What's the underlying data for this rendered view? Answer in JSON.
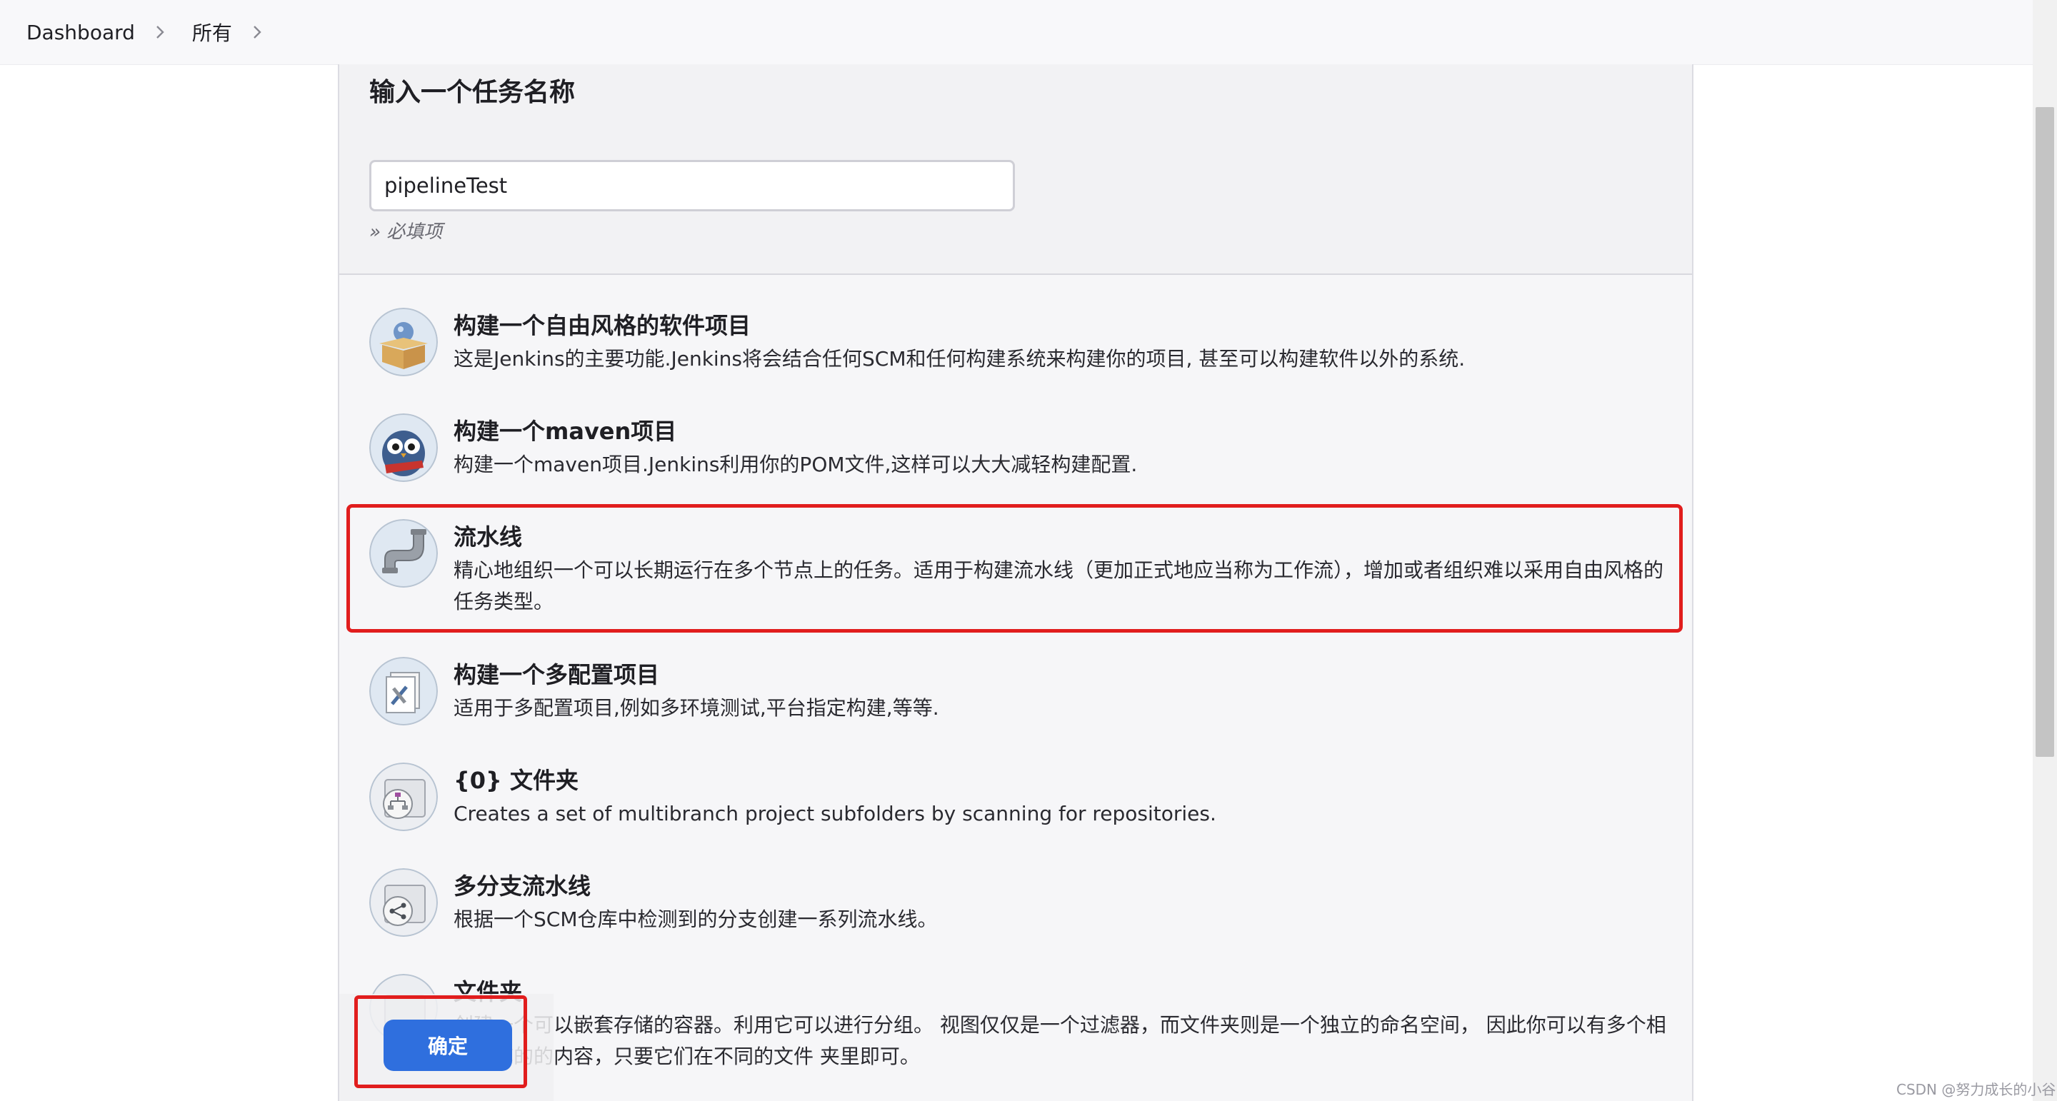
{
  "breadcrumb": {
    "items": [
      "Dashboard",
      "所有"
    ]
  },
  "form": {
    "title": "输入一个任务名称",
    "name_value": "pipelineTest",
    "required_hint": "» 必填项"
  },
  "job_types": [
    {
      "title": "构建一个自由风格的软件项目",
      "description": "这是Jenkins的主要功能.Jenkins将会结合任何SCM和任何构建系统来构建你的项目, 甚至可以构建软件以外的系统.",
      "icon": "freestyle-box-icon"
    },
    {
      "title": "构建一个maven项目",
      "description": "构建一个maven项目.Jenkins利用你的POM文件,这样可以大大减轻构建配置.",
      "icon": "maven-owl-icon"
    },
    {
      "title": "流水线",
      "description": "精心地组织一个可以长期运行在多个节点上的任务。适用于构建流水线（更加正式地应当称为工作流），增加或者组织难以采用自由风格的任务类型。",
      "icon": "pipeline-pipe-icon"
    },
    {
      "title": "构建一个多配置项目",
      "description": "适用于多配置项目,例如多环境测试,平台指定构建,等等.",
      "icon": "multi-config-icon"
    },
    {
      "title": "{0} 文件夹",
      "description": "Creates a set of multibranch project subfolders by scanning for repositories.",
      "icon": "org-folder-icon"
    },
    {
      "title": "多分支流水线",
      "description": "根据一个SCM仓库中检测到的分支创建一系列流水线。",
      "icon": "multibranch-icon"
    },
    {
      "title": "文件夹",
      "description": "创建一个可以嵌套存储的容器。利用它可以进行分组。 视图仅仅是一个过滤器，而文件夹则是一个独立的命名空间， 因此你可以有多个相同名称的的内容，只要它们在不同的文件 夹里即可。",
      "icon": "folder-icon"
    }
  ],
  "footer": {
    "ok_label": "确定"
  },
  "watermark": "CSDN @努力成长的小谷",
  "colors": {
    "accent": "#2f6fde",
    "highlight": "#e11d1d"
  }
}
